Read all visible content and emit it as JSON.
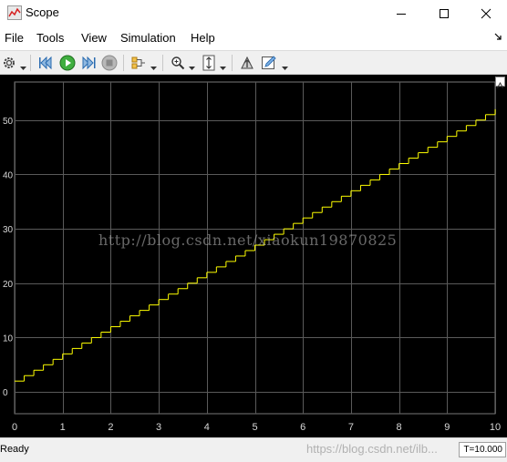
{
  "window": {
    "title": "Scope",
    "controls": [
      "minimize-icon",
      "maximize-icon",
      "close-icon"
    ]
  },
  "menu": {
    "items": [
      "File",
      "Tools",
      "View",
      "Simulation",
      "Help"
    ]
  },
  "toolbar": {
    "icons": [
      "gear-icon",
      "step-back-icon",
      "run-icon",
      "step-forward-icon",
      "stop-icon",
      "highlight-signal-icon",
      "zoom-in-icon",
      "autoscale-icon",
      "write-access-icon",
      "edit-pencil-icon"
    ]
  },
  "colors": {
    "plot_background": "#000000",
    "grid": "#5a5a5a",
    "trace": "#ffff00",
    "tick_text": "#d8d8d8"
  },
  "watermark": "http://blog.csdn.net/xiaokun19870825",
  "status": {
    "text": "Ready",
    "watermark": "https://blog.csdn.net/ilb...",
    "time": "T=10.000"
  },
  "chart_data": {
    "type": "line",
    "style": "staircase",
    "title": "",
    "xlabel": "",
    "ylabel": "",
    "xlim": [
      0,
      10
    ],
    "ylim": [
      -4,
      57
    ],
    "x_ticks": [
      "0",
      "1",
      "2",
      "3",
      "4",
      "5",
      "6",
      "7",
      "8",
      "9",
      "10"
    ],
    "y_ticks": [
      "0",
      "10",
      "20",
      "30",
      "40",
      "50"
    ],
    "x_ticks_values": [
      0,
      1,
      2,
      3,
      4,
      5,
      6,
      7,
      8,
      9,
      10
    ],
    "y_ticks_values": [
      0,
      10,
      20,
      30,
      40,
      50
    ],
    "grid": true,
    "series": [
      {
        "color": "#ffff00",
        "step": 0.2,
        "x": [
          0,
          0.2,
          0.4,
          0.6,
          0.8,
          1,
          1.2,
          1.4,
          1.6,
          1.8,
          2,
          2.2,
          2.4,
          2.6,
          2.8,
          3,
          3.2,
          3.4,
          3.6,
          3.8,
          4,
          4.2,
          4.4,
          4.6,
          4.8,
          5,
          5.2,
          5.4,
          5.6,
          5.8,
          6,
          6.2,
          6.4,
          6.6,
          6.8,
          7,
          7.2,
          7.4,
          7.6,
          7.8,
          8,
          8.2,
          8.4,
          8.6,
          8.8,
          9,
          9.2,
          9.4,
          9.6,
          9.8,
          10
        ],
        "y": [
          2,
          3,
          4,
          5,
          6,
          7,
          8,
          9,
          10,
          11,
          12,
          13,
          14,
          15,
          16,
          17,
          18,
          19,
          20,
          21,
          22,
          23,
          24,
          25,
          26,
          27,
          28,
          29,
          30,
          31,
          32,
          33,
          34,
          35,
          36,
          37,
          38,
          39,
          40,
          41,
          42,
          43,
          44,
          45,
          46,
          47,
          48,
          49,
          50,
          51,
          52
        ]
      }
    ]
  }
}
